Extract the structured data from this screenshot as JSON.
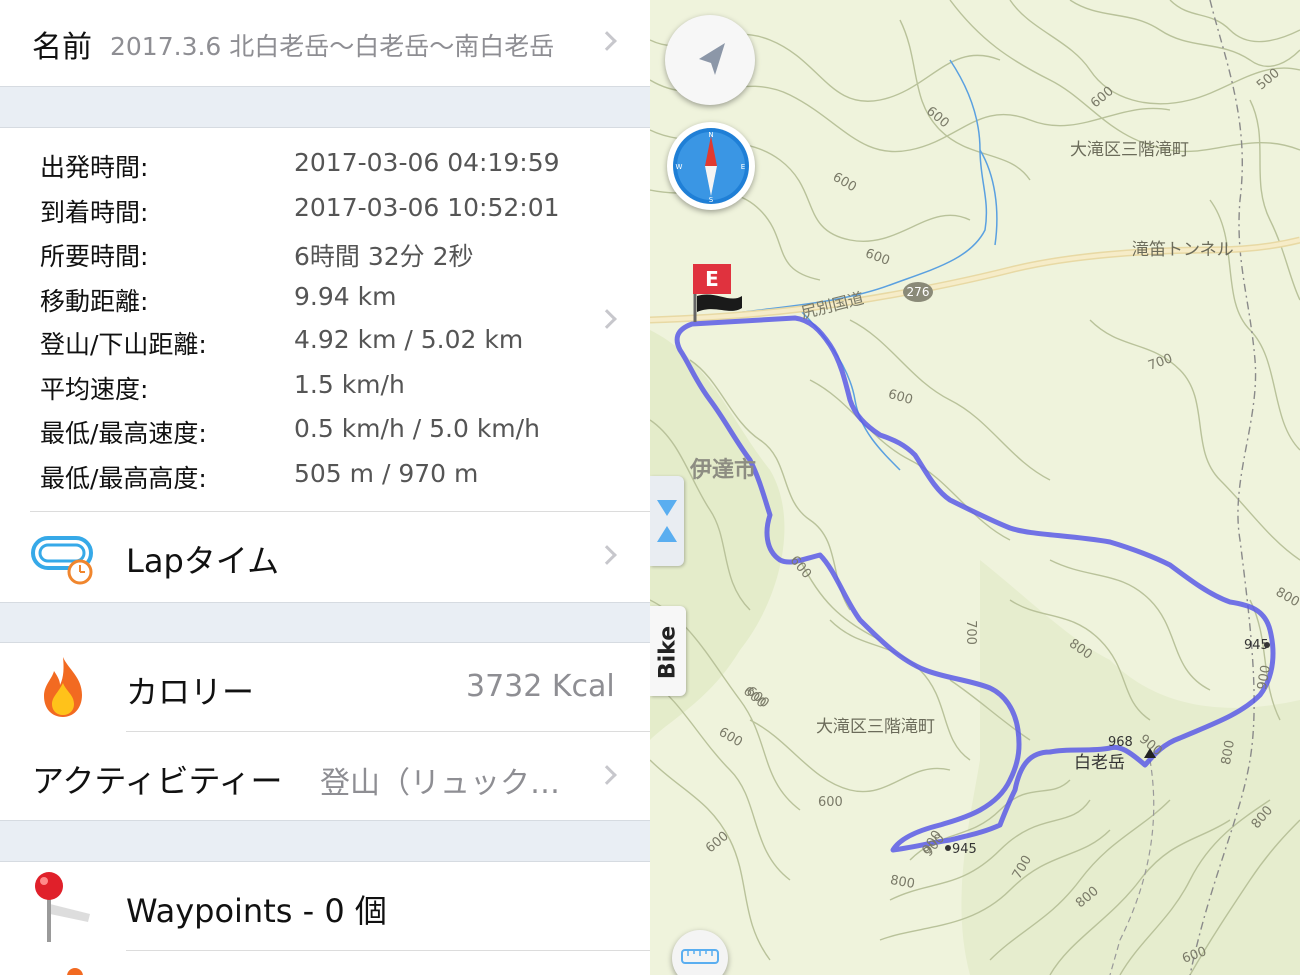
{
  "name_row": {
    "label": "名前",
    "value": "2017.3.6 北白老岳〜白老岳〜南白老岳"
  },
  "stats": [
    {
      "label": "出発時間:",
      "value": "2017-03-06 04:19:59"
    },
    {
      "label": "到着時間:",
      "value": "2017-03-06 10:52:01"
    },
    {
      "label": "所要時間:",
      "value": "6時間 32分 2秒"
    },
    {
      "label": "移動距離:",
      "value": "9.94 km"
    },
    {
      "label": "登山/下山距離:",
      "value": "4.92 km / 5.02 km"
    },
    {
      "label": "平均速度:",
      "value": "1.5 km/h"
    },
    {
      "label": "最低/最高速度:",
      "value": "0.5 km/h / 5.0 km/h"
    },
    {
      "label": "最低/最高高度:",
      "value": "505 m / 970 m"
    }
  ],
  "lap": {
    "label": "Lapタイム"
  },
  "calorie": {
    "label": "カロリー",
    "value": "3732 Kcal"
  },
  "activity": {
    "label": "アクティビティー",
    "value": "登山（リュック…"
  },
  "waypoints": {
    "label": "Waypoints - 0 個"
  },
  "map": {
    "end_flag": "E",
    "bike_tab": "Bike",
    "labels": {
      "city": "伊達市",
      "district_top": "大滝区三階滝町",
      "district_bottom": "大滝区三階滝町",
      "tunnel": "滝笛トンネル",
      "road": "尻別国道",
      "route_no": "276",
      "peak": "白老岳",
      "peak_elev": "968",
      "end_elev": "945",
      "east_elev": "945"
    },
    "contour_labels": [
      "600",
      "600",
      "600",
      "600",
      "600",
      "700",
      "700",
      "600",
      "600",
      "800",
      "800",
      "900",
      "900",
      "900",
      "800",
      "700",
      "800",
      "600",
      "600",
      "600",
      "800",
      "900",
      "800",
      "600",
      "500",
      "600"
    ],
    "colors": {
      "track": "#5b5be6",
      "water": "#5aa0e0",
      "road": "#f2e4b8",
      "contour": "#b9c29a",
      "land": "#eff3dc"
    }
  }
}
